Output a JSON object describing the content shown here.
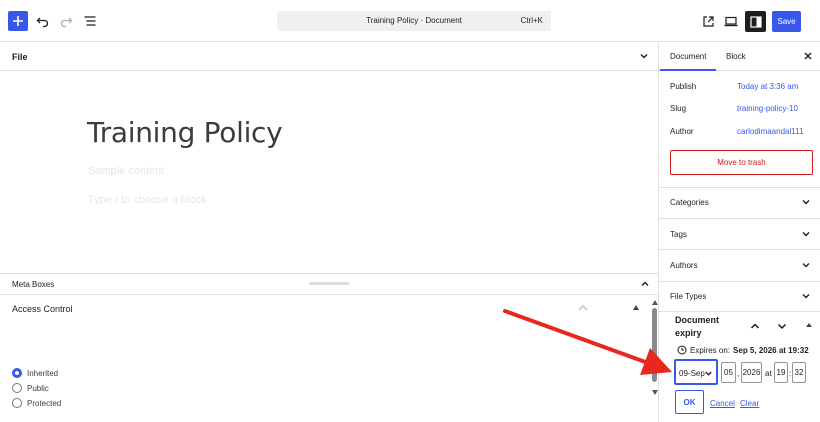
{
  "toolbar": {
    "title": "Training Policy · Document",
    "shortcut": "Ctrl+K",
    "save_label": "Save",
    "accent": "#3858e9"
  },
  "editor": {
    "file_label": "File",
    "post_title": "Training Policy",
    "sample_text": "Sample content",
    "block_placeholder": "Type / to choose a block"
  },
  "meta_boxes": {
    "title": "Meta Boxes",
    "access_control": {
      "title": "Access Control",
      "options": [
        {
          "label": "Inherited",
          "checked": true
        },
        {
          "label": "Public",
          "checked": false
        },
        {
          "label": "Protected",
          "checked": false
        }
      ]
    }
  },
  "sidebar": {
    "tabs": [
      "Document",
      "Block"
    ],
    "publish": {
      "label": "Publish",
      "value": "Today at 3:36 am"
    },
    "slug": {
      "label": "Slug",
      "value": "training-policy-10"
    },
    "author": {
      "label": "Author",
      "value": "carlodimaandal111"
    },
    "trash_label": "Move to trash",
    "trash_color": "#cc1818",
    "panels": [
      "Categories",
      "Tags",
      "Authors",
      "File Types"
    ],
    "expiry": {
      "title": "Document expiry",
      "expires_prefix": "Expires on:",
      "expires_value": "Sep 5, 2026 at 19:32",
      "month": "09-Sep",
      "day": "05",
      "year": "2026",
      "at": "at",
      "hour": "19",
      "minute": "32",
      "ok_label": "OK",
      "cancel_label": "Cancel",
      "clear_label": "Clear"
    }
  },
  "annotation": {
    "arrow_color": "#e8271f"
  }
}
